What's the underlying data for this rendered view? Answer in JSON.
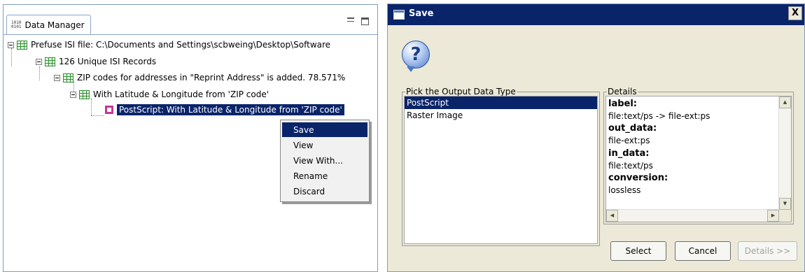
{
  "data_manager": {
    "tab_title": "Data Manager",
    "tab_icon_text": "1010\n0101",
    "tree": [
      {
        "label": "Prefuse ISI file: C:\\Documents and Settings\\scbweing\\Desktop\\Software"
      },
      {
        "label": "126 Unique ISI Records"
      },
      {
        "label": "ZIP codes for addresses in \"Reprint Address\" is added. 78.571%"
      },
      {
        "label": "With Latitude & Longitude from 'ZIP code'"
      },
      {
        "label": "PostScript: With Latitude & Longitude from 'ZIP code'"
      }
    ],
    "context_menu": [
      "Save",
      "View",
      "View With...",
      "Rename",
      "Discard"
    ]
  },
  "dialog": {
    "title": "Save",
    "close_label": "X",
    "help_glyph": "?",
    "pick_label": "Pick the Output Data Type",
    "output_types": [
      "PostScript",
      "Raster Image"
    ],
    "selected_type": "PostScript",
    "details_label": "Details",
    "details": [
      {
        "key": "label:",
        "value": "file:text/ps -> file-ext:ps"
      },
      {
        "key": "out_data:",
        "value": "file-ext:ps"
      },
      {
        "key": "in_data:",
        "value": "file:text/ps"
      },
      {
        "key": "conversion:",
        "value": "lossless"
      }
    ],
    "buttons": {
      "select": "Select",
      "cancel": "Cancel",
      "details": "Details >>"
    }
  },
  "colors": {
    "selection": "#0a246a",
    "dialog_bg": "#ece9d8",
    "table_icon": "#2f8f2f",
    "ps_icon": "#cc3399"
  }
}
